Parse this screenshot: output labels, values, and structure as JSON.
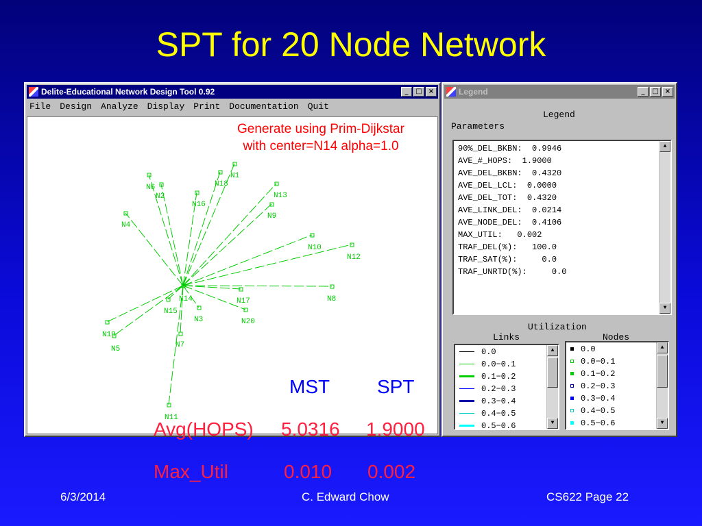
{
  "slide": {
    "title": "SPT for 20 Node Network",
    "footer_date": "6/3/2014",
    "footer_author": "C. Edward Chow",
    "footer_page": "CS622 Page 22"
  },
  "app": {
    "title": "Delite-Educational Network Design Tool 0.92",
    "menu": [
      "File",
      "Design",
      "Analyze",
      "Display",
      "Print",
      "Documentation",
      "Quit"
    ],
    "annotation_line1": "Generate using Prim-Dijkstar",
    "annotation_line2": "with center=N14 alpha=1.0"
  },
  "network": {
    "center": "N14",
    "link_color": "#00cc00",
    "nodes": [
      {
        "id": "N1"
      },
      {
        "id": "N2"
      },
      {
        "id": "N3"
      },
      {
        "id": "N4"
      },
      {
        "id": "N5"
      },
      {
        "id": "N6"
      },
      {
        "id": "N7"
      },
      {
        "id": "N8"
      },
      {
        "id": "N9"
      },
      {
        "id": "N10"
      },
      {
        "id": "N11"
      },
      {
        "id": "N12"
      },
      {
        "id": "N13"
      },
      {
        "id": "N14"
      },
      {
        "id": "N15"
      },
      {
        "id": "N16"
      },
      {
        "id": "N17"
      },
      {
        "id": "N18"
      },
      {
        "id": "N19"
      },
      {
        "id": "N20"
      }
    ]
  },
  "legend": {
    "title": "Legend",
    "window_title": "Legend",
    "parameters_label": "Parameters",
    "parameters": [
      "90%_DEL_BKBN:  0.9946",
      "AVE_#_HOPS:  1.9000",
      "AVE_DEL_BKBN:  0.4320",
      "AVE_DEL_LCL:  0.0000",
      "AVE_DEL_TOT:  0.4320",
      "AVE_LINK_DEL:  0.0214",
      "AVE_NODE_DEL:  0.4106",
      "MAX_UTIL:   0.002",
      "TRAF_DEL(%):   100.0",
      "TRAF_SAT(%):     0.0",
      "TRAF_UNRTD(%):     0.0"
    ],
    "utilization_label": "Utilization",
    "links_label": "Links",
    "nodes_label": "Nodes",
    "link_ranges": [
      {
        "label": "0.0",
        "color": "#000000"
      },
      {
        "label": "0.0−0.1",
        "color": "#00cc00"
      },
      {
        "label": "0.1−0.2",
        "color": "#00cc00"
      },
      {
        "label": "0.2−0.3",
        "color": "#0000ff"
      },
      {
        "label": "0.3−0.4",
        "color": "#0000aa"
      },
      {
        "label": "0.4−0.5",
        "color": "#00cccc"
      },
      {
        "label": "0.5−0.6",
        "color": "#00ffff"
      }
    ],
    "node_ranges": [
      {
        "label": "0.0",
        "color": "#000000"
      },
      {
        "label": "0.0−0.1",
        "color": "#00cc00"
      },
      {
        "label": "0.1−0.2",
        "color": "#00cc00"
      },
      {
        "label": "0.2−0.3",
        "color": "#0000aa"
      },
      {
        "label": "0.3−0.4",
        "color": "#0000ff"
      },
      {
        "label": "0.4−0.5",
        "color": "#00cccc"
      },
      {
        "label": "0.5−0.6",
        "color": "#00ffff"
      }
    ]
  },
  "stats": {
    "col_mst": "MST",
    "col_spt": "SPT",
    "hops_label": "Avg(HOPS)",
    "hops_mst": "5.0316",
    "hops_spt": "1.9000",
    "util_label": "Max_Util",
    "util_mst": "0.010",
    "util_spt": "0.002"
  }
}
